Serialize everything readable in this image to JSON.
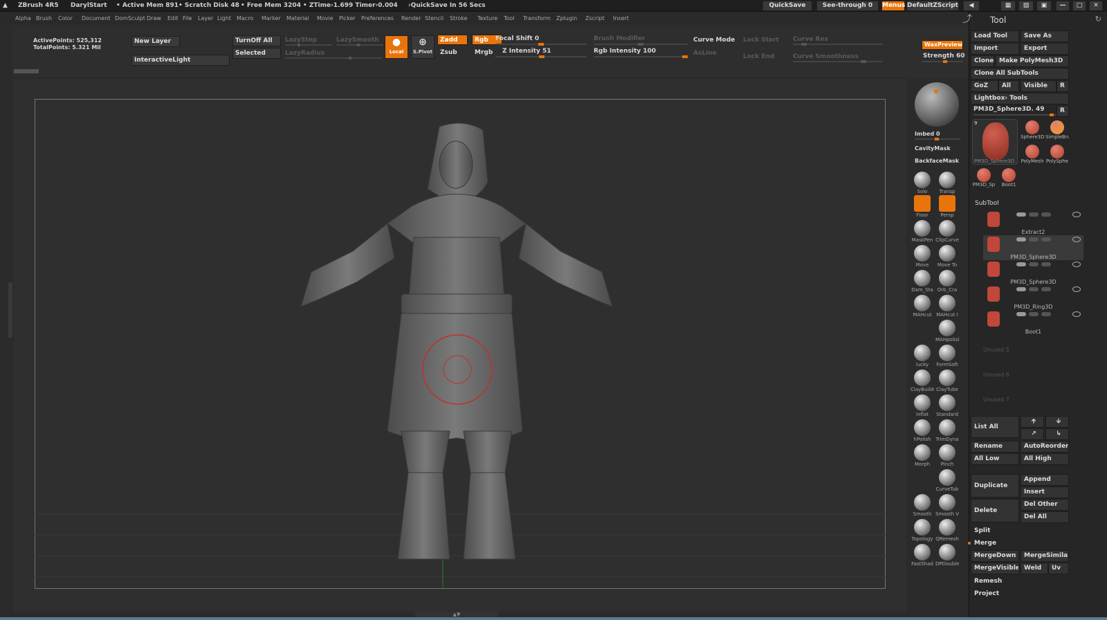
{
  "title_bar": {
    "app_name": "ZBrush 4R5",
    "doc_name": "DarylStart",
    "active_mem": "• Active Mem 891",
    "scratch_disk": "• Scratch Disk 48",
    "free_mem": "• Free Mem 3204",
    "ztime": "• ZTime›1.699 Timer›0.004",
    "quicksave_in": "›QuickSave In 56 Secs",
    "quicksave_btn": "QuickSave",
    "see_through": "See-through  0",
    "menus_btn": "Menus",
    "script_btn": "DefaultZScript"
  },
  "menu_items": [
    "Alpha",
    "Brush",
    "Color",
    "Document",
    "DomSculpt",
    "Draw",
    "Edit",
    "File",
    "Layer",
    "Light",
    "Macro",
    "Marker",
    "Material",
    "Movie",
    "Picker",
    "Preferences",
    "Render",
    "Stencil",
    "Stroke",
    "Texture",
    "Tool",
    "Transform",
    "Zplugin",
    "Zscript",
    "Insert"
  ],
  "top_shelf": {
    "active_points": "ActivePoints: 525,312",
    "total_points": "TotalPoints: 5.321  Mil",
    "new_layer": "New Layer",
    "interactive_light": "InteractiveLight",
    "turnoff_all": "TurnOff  All",
    "selected": "Selected",
    "lazy_step": "LazyStep",
    "lazy_smooth": "LazySmooth",
    "lazy_radius": "LazyRadius",
    "local": "Local",
    "spivot": "S.Pivot",
    "zadd": "Zadd",
    "zsub": "Zsub",
    "rgb": "Rgb",
    "mrgb": "Mrgb",
    "focal_shift": "Focal Shift 0",
    "z_intensity": "Z Intensity 51",
    "brush_modifier": "Brush Modifier",
    "rgb_intensity": "Rgb  Intensity 100",
    "curve_mode": "Curve Mode",
    "asline": "AsLine",
    "lock_start": "Lock Start",
    "lock_end": "Lock End",
    "curve_res": "Curve Res",
    "curve_smoothness": "Curve Smoothness",
    "wax_preview": "WaxPreview",
    "strength": "Strength 60"
  },
  "right_shelf": {
    "imbed": "Imbed 0",
    "cavity_mask": "CavityMask",
    "backface_mask": "BackfaceMask",
    "tools": [
      {
        "name": "Solo",
        "icon": "solo-icon"
      },
      {
        "name": "Transp",
        "icon": "transparency-icon"
      },
      {
        "name": "Floor",
        "icon": "floor-icon"
      },
      {
        "name": "Persp",
        "icon": "perspective-icon"
      },
      {
        "name": "MaskPen",
        "icon": "maskpen-brush-icon"
      },
      {
        "name": "ClipCurve",
        "icon": "clipcurve-brush-icon"
      },
      {
        "name": "Move",
        "icon": "move-brush-icon"
      },
      {
        "name": "Move To",
        "icon": "move-topological-brush-icon"
      },
      {
        "name": "Dam_Sta",
        "icon": "damstandard-brush-icon"
      },
      {
        "name": "Orb_Cra",
        "icon": "orb-cracks-brush-icon"
      },
      {
        "name": "MAHcut",
        "icon": "mahcut-brush-icon"
      },
      {
        "name": "MAHcut I",
        "icon": "mahcut-brush-icon"
      },
      {
        "name": "MAHpolish",
        "icon": "mahpolish-brush-icon"
      },
      {
        "name": "lucky",
        "icon": "lucky-brush-icon"
      },
      {
        "name": "FormSoft",
        "icon": "formsoft-brush-icon"
      },
      {
        "name": "ClayBuildu",
        "icon": "claybuildup-brush-icon"
      },
      {
        "name": "ClayTube",
        "icon": "claytubes-brush-icon"
      },
      {
        "name": "Inflat",
        "icon": "inflate-brush-icon"
      },
      {
        "name": "Standard",
        "icon": "standard-brush-icon"
      },
      {
        "name": "hPolish",
        "icon": "hpolish-brush-icon"
      },
      {
        "name": "TrimDyna",
        "icon": "trimdynamic-brush-icon"
      },
      {
        "name": "Morph",
        "icon": "morph-brush-icon"
      },
      {
        "name": "Pinch",
        "icon": "pinch-brush-icon"
      },
      {
        "name": "CurveTub",
        "icon": "curvetube-brush-icon"
      },
      {
        "name": "Smooth",
        "icon": "smooth-brush-icon"
      },
      {
        "name": "Smooth V",
        "icon": "smooth-valleys-brush-icon"
      },
      {
        "name": "Topology",
        "icon": "topology-brush-icon"
      },
      {
        "name": "QRemesh",
        "icon": "qremesher-brush-icon"
      },
      {
        "name": "FastShad",
        "icon": "fastshader-material-icon"
      },
      {
        "name": "DPDouble",
        "icon": "dpdouble-material-icon"
      }
    ]
  },
  "tool_panel": {
    "header": "Tool",
    "load_tool": "Load Tool",
    "save_as": "Save As",
    "import": "Import",
    "export": "Export",
    "clone": "Clone",
    "make_polymesh": "Make PolyMesh3D",
    "clone_all": "Clone  All  SubTools",
    "goz": "GoZ",
    "all": "All",
    "visible": "Visible",
    "r": "R",
    "lightbox_tools": "Lightbox› Tools",
    "current_tool": "PM3D_Sphere3D. 49",
    "thumb_main_label": "PM3D_Sphere3D",
    "thumb_count": "9",
    "thumbs": [
      "Sphere3D",
      "SimpleBru",
      "PolyMesh",
      "PolySphe",
      "PM3D_Sp",
      "Boot1"
    ],
    "subtool_header": "SubTool",
    "subtools": [
      "Extract2",
      "PM3D_Sphere3D",
      "PM3D_Sphere3D",
      "PM3D_Ring3D",
      "Boot1",
      "Unused  5",
      "Unused  6",
      "Unused  7"
    ],
    "list_all": "List  All",
    "rename": "Rename",
    "auto_reorder": "AutoReorder",
    "all_low": "All  Low",
    "all_high": "All  High",
    "duplicate": "Duplicate",
    "append": "Append",
    "insert": "Insert",
    "delete": "Delete",
    "del_other": "Del  Other",
    "del_all": "Del  All",
    "split": "Split",
    "merge": "Merge",
    "merge_down": "MergeDown",
    "merge_similar": "MergeSimilar",
    "merge_visible": "MergeVisible",
    "weld": "Weld",
    "uv": "Uv",
    "remesh": "Remesh",
    "project": "Project"
  },
  "sliders": {
    "lazy_step": 0.3,
    "lazy_smooth": 0.5,
    "lazy_radius": 0.7,
    "focal_shift": 0.5,
    "z_intensity": 0.51,
    "brush_modifier": 0.5,
    "rgb_intensity": 1.0,
    "curve_res": 0.1,
    "curve_smoothness": 0.8,
    "strength": 0.6,
    "imbed": 0.5
  },
  "colors": {
    "accent": "#e8740c",
    "background": "#2b2b2b",
    "model": "#6a6a6a",
    "brush_cursor": "#c0302a",
    "subtool": "#c0473a"
  }
}
